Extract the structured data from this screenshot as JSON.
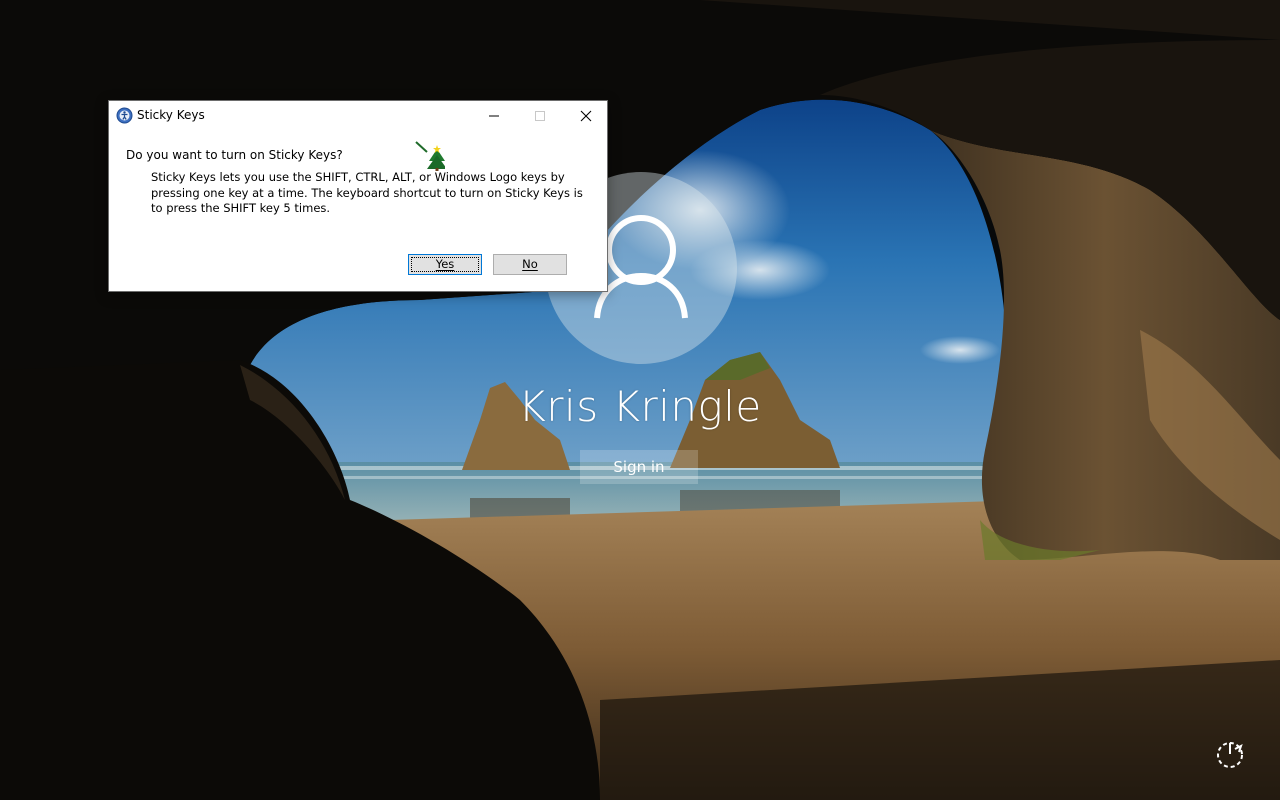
{
  "lock_screen": {
    "user_name": "Kris Kringle",
    "sign_in_label": "Sign in",
    "power_icon": "power-options-icon"
  },
  "dialog": {
    "title": "Sticky Keys",
    "title_icon": "accessibility-icon",
    "question": "Do you want to turn on Sticky Keys?",
    "description": "Sticky Keys lets you use the SHIFT, CTRL, ALT, or Windows Logo keys by pressing one key at a time. The keyboard shortcut to turn on Sticky Keys is to press the SHIFT key 5 times.",
    "yes_label": "Yes",
    "no_label": "No",
    "controls": [
      "minimize",
      "maximize",
      "close"
    ]
  },
  "colors": {
    "dialog_bg": "#ffffff",
    "button_bg": "#e1e1e1",
    "focus_border": "#0078d7",
    "sky": "#1b5ea1",
    "sand": "#8f6a41"
  }
}
